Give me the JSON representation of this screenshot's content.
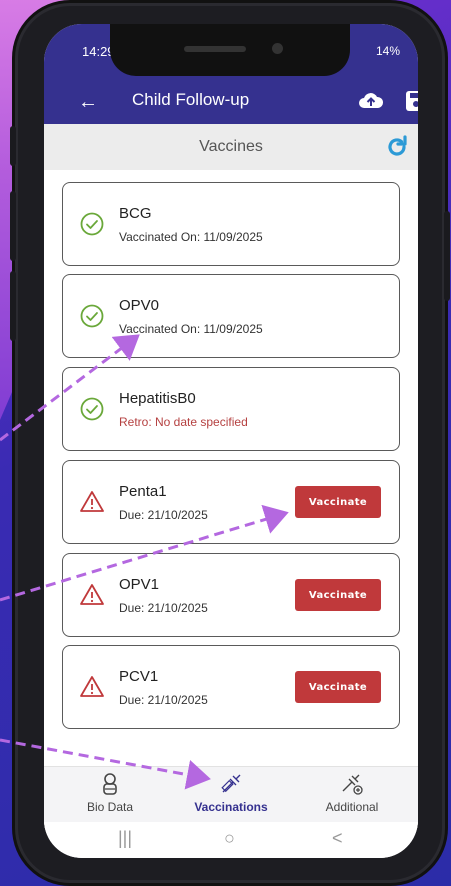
{
  "status_bar": {
    "time": "14:29",
    "battery": "14%"
  },
  "appbar": {
    "title": "Child Follow-up"
  },
  "section": {
    "title": "Vaccines"
  },
  "vaccines": [
    {
      "name": "BCG",
      "detail": "Vaccinated On: 11/09/2025",
      "status": "done"
    },
    {
      "name": "OPV0",
      "detail": "Vaccinated On: 11/09/2025",
      "status": "done"
    },
    {
      "name": "HepatitisB0",
      "detail": "Retro: No date specified",
      "status": "retro"
    },
    {
      "name": "Penta1",
      "detail": "Due: 21/10/2025",
      "status": "due",
      "action": "Vaccinate"
    },
    {
      "name": "OPV1",
      "detail": "Due: 21/10/2025",
      "status": "due",
      "action": "Vaccinate"
    },
    {
      "name": "PCV1",
      "detail": "Due: 21/10/2025",
      "status": "due",
      "action": "Vaccinate"
    }
  ],
  "bottom_nav": [
    {
      "label": "Bio Data",
      "icon": "baby-icon"
    },
    {
      "label": "Vaccinations",
      "icon": "syringe-icon",
      "active": true
    },
    {
      "label": "Additional",
      "icon": "syringe-plus-icon"
    }
  ],
  "colors": {
    "primary": "#35318f",
    "danger": "#c0393b",
    "success": "#6aa83a",
    "refresh": "#2c9ad6",
    "annotation": "#b468e0"
  }
}
